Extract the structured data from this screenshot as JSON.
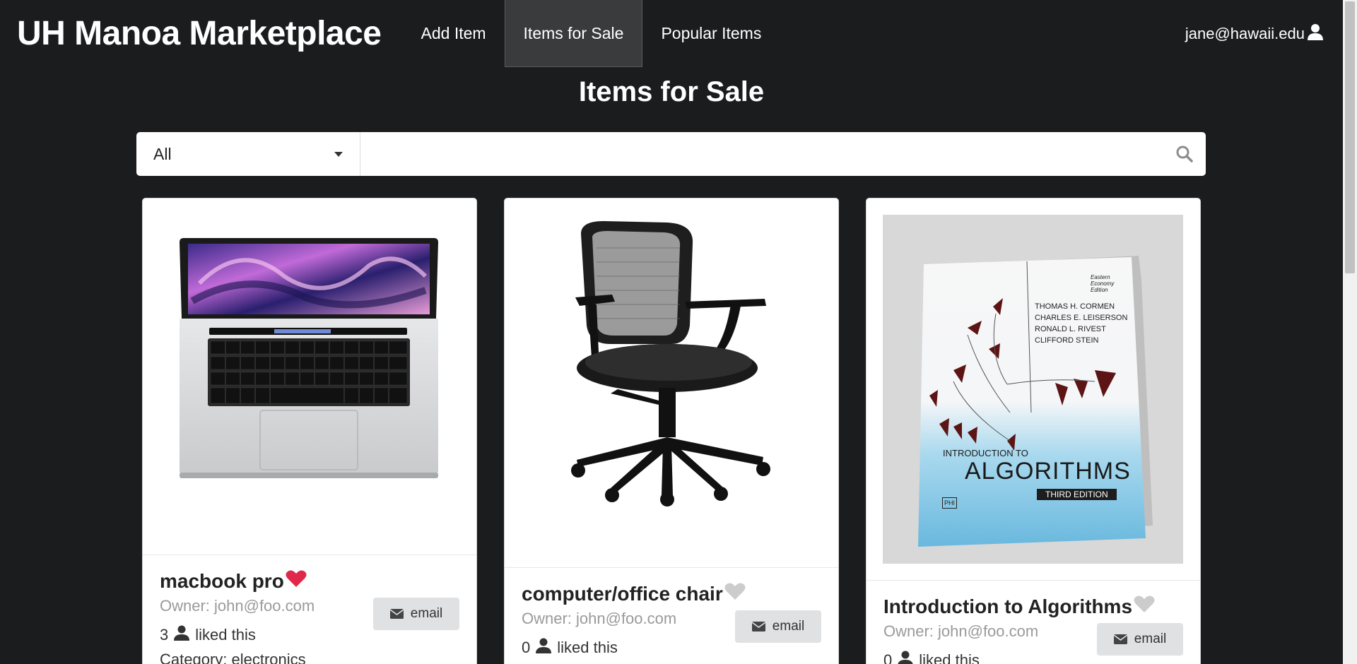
{
  "navbar": {
    "brand": "UH Manoa Marketplace",
    "items": [
      {
        "label": "Add Item"
      },
      {
        "label": "Items for Sale"
      },
      {
        "label": "Popular Items"
      }
    ],
    "user": "jane@hawaii.edu"
  },
  "page": {
    "title": "Items for Sale"
  },
  "search": {
    "category_selected": "All",
    "query": "",
    "placeholder": ""
  },
  "colors": {
    "background": "#1b1c1d",
    "liked_heart": "#e0294a",
    "unliked_heart": "#cccccc"
  },
  "items": [
    {
      "name": "macbook pro",
      "liked": true,
      "owner": "Owner: john@foo.com",
      "likes_count": "3",
      "likes_text": "liked this",
      "category": "Category: electronics",
      "email_label": "email"
    },
    {
      "name": "computer/office chair",
      "liked": false,
      "owner": "Owner: john@foo.com",
      "likes_count": "0",
      "likes_text": "liked this",
      "email_label": "email"
    },
    {
      "name": "Introduction to Algorithms",
      "liked": false,
      "owner": "Owner: john@foo.com",
      "likes_count": "0",
      "likes_text": "liked this",
      "email_label": "email",
      "book": {
        "authors": [
          "THOMAS H. CORMEN",
          "CHARLES E. LEISERSON",
          "RONALD L. RIVEST",
          "CLIFFORD STEIN"
        ],
        "subtitle": "INTRODUCTION TO",
        "title": "ALGORITHMS",
        "edition": "THIRD EDITION",
        "corner_text": "Eastern Economy Edition",
        "publisher_mark": "PHI"
      }
    }
  ]
}
